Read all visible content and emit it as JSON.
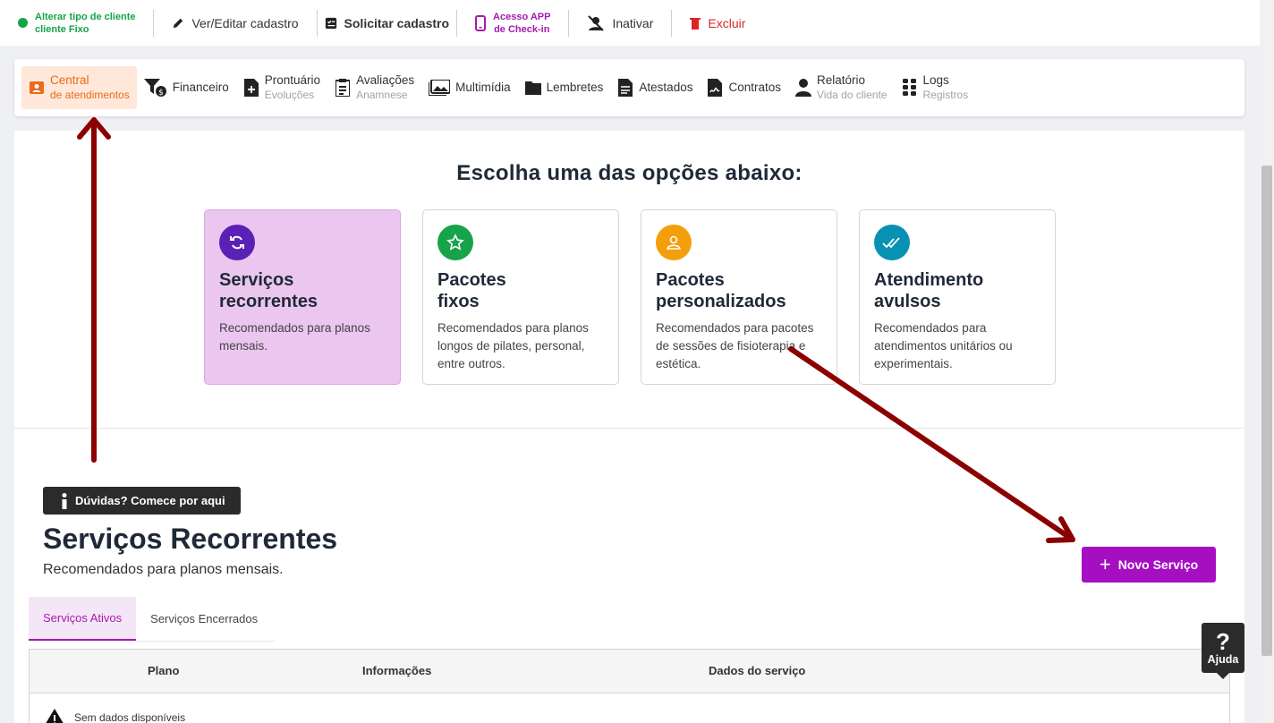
{
  "topbar": {
    "client_type_label": "Alterar tipo de cliente",
    "client_type_value": "cliente Fixo",
    "edit_label": "Ver/Editar cadastro",
    "request_label": "Solicitar cadastro",
    "app_access_line1": "Acesso APP",
    "app_access_line2": "de Check-in",
    "deactivate_label": "Inativar",
    "delete_label": "Excluir"
  },
  "nav": {
    "items": [
      {
        "main": "Central",
        "sub": "de atendimentos",
        "icon": "contact-card-icon"
      },
      {
        "main": "Financeiro",
        "sub": "",
        "icon": "money-filter-icon"
      },
      {
        "main": "Prontuário",
        "sub": "Evoluções",
        "icon": "file-plus-icon"
      },
      {
        "main": "Avaliações",
        "sub": "Anamnese",
        "icon": "clipboard-icon"
      },
      {
        "main": "Multimídia",
        "sub": "",
        "icon": "images-icon"
      },
      {
        "main": "Lembretes",
        "sub": "",
        "icon": "folder-icon"
      },
      {
        "main": "Atestados",
        "sub": "",
        "icon": "document-icon"
      },
      {
        "main": "Contratos",
        "sub": "",
        "icon": "signature-document-icon"
      },
      {
        "main": "Relatório",
        "sub": "Vida do cliente",
        "icon": "person-icon"
      },
      {
        "main": "Logs",
        "sub": "Registros",
        "icon": "grid-dots-icon"
      }
    ]
  },
  "main": {
    "choose_title": "Escolha uma das opções abaixo:",
    "cards": [
      {
        "title1": "Serviços",
        "title2": "recorrentes",
        "desc": "Recomendados para planos mensais.",
        "icon": "recurring-icon",
        "color": "#5b21b6"
      },
      {
        "title1": "Pacotes",
        "title2": "fixos",
        "desc": "Recomendados para planos longos de pilates, personal, entre outros.",
        "icon": "star-icon",
        "color": "#16a34a"
      },
      {
        "title1": "Pacotes",
        "title2": "personalizados",
        "desc": "Recomendados para pacotes de sessões de fisioterapia e estética.",
        "icon": "user-icon",
        "color": "#f59e0b"
      },
      {
        "title1": "Atendimento",
        "title2": "avulsos",
        "desc": "Recomendados para atendimentos unitários ou experimentais.",
        "icon": "double-check-icon",
        "color": "#0891b2"
      }
    ],
    "help_button": "Dúvidas? Comece por aqui",
    "section_title": "Serviços Recorrentes",
    "section_subtitle": "Recomendados para planos mensais.",
    "new_service_button": "Novo Serviço",
    "tabs": [
      "Serviços Ativos",
      "Serviços Encerrados"
    ],
    "table": {
      "headers": [
        "Plano",
        "Informações",
        "Dados do serviço"
      ],
      "empty_text": "Sem dados disponíveis"
    }
  },
  "ajuda": {
    "icon_char": "?",
    "label": "Ajuda"
  },
  "colors": {
    "accent_purple": "#a60ec2",
    "active_orange": "#ea6a1c",
    "arrow_red": "#8b0000"
  }
}
